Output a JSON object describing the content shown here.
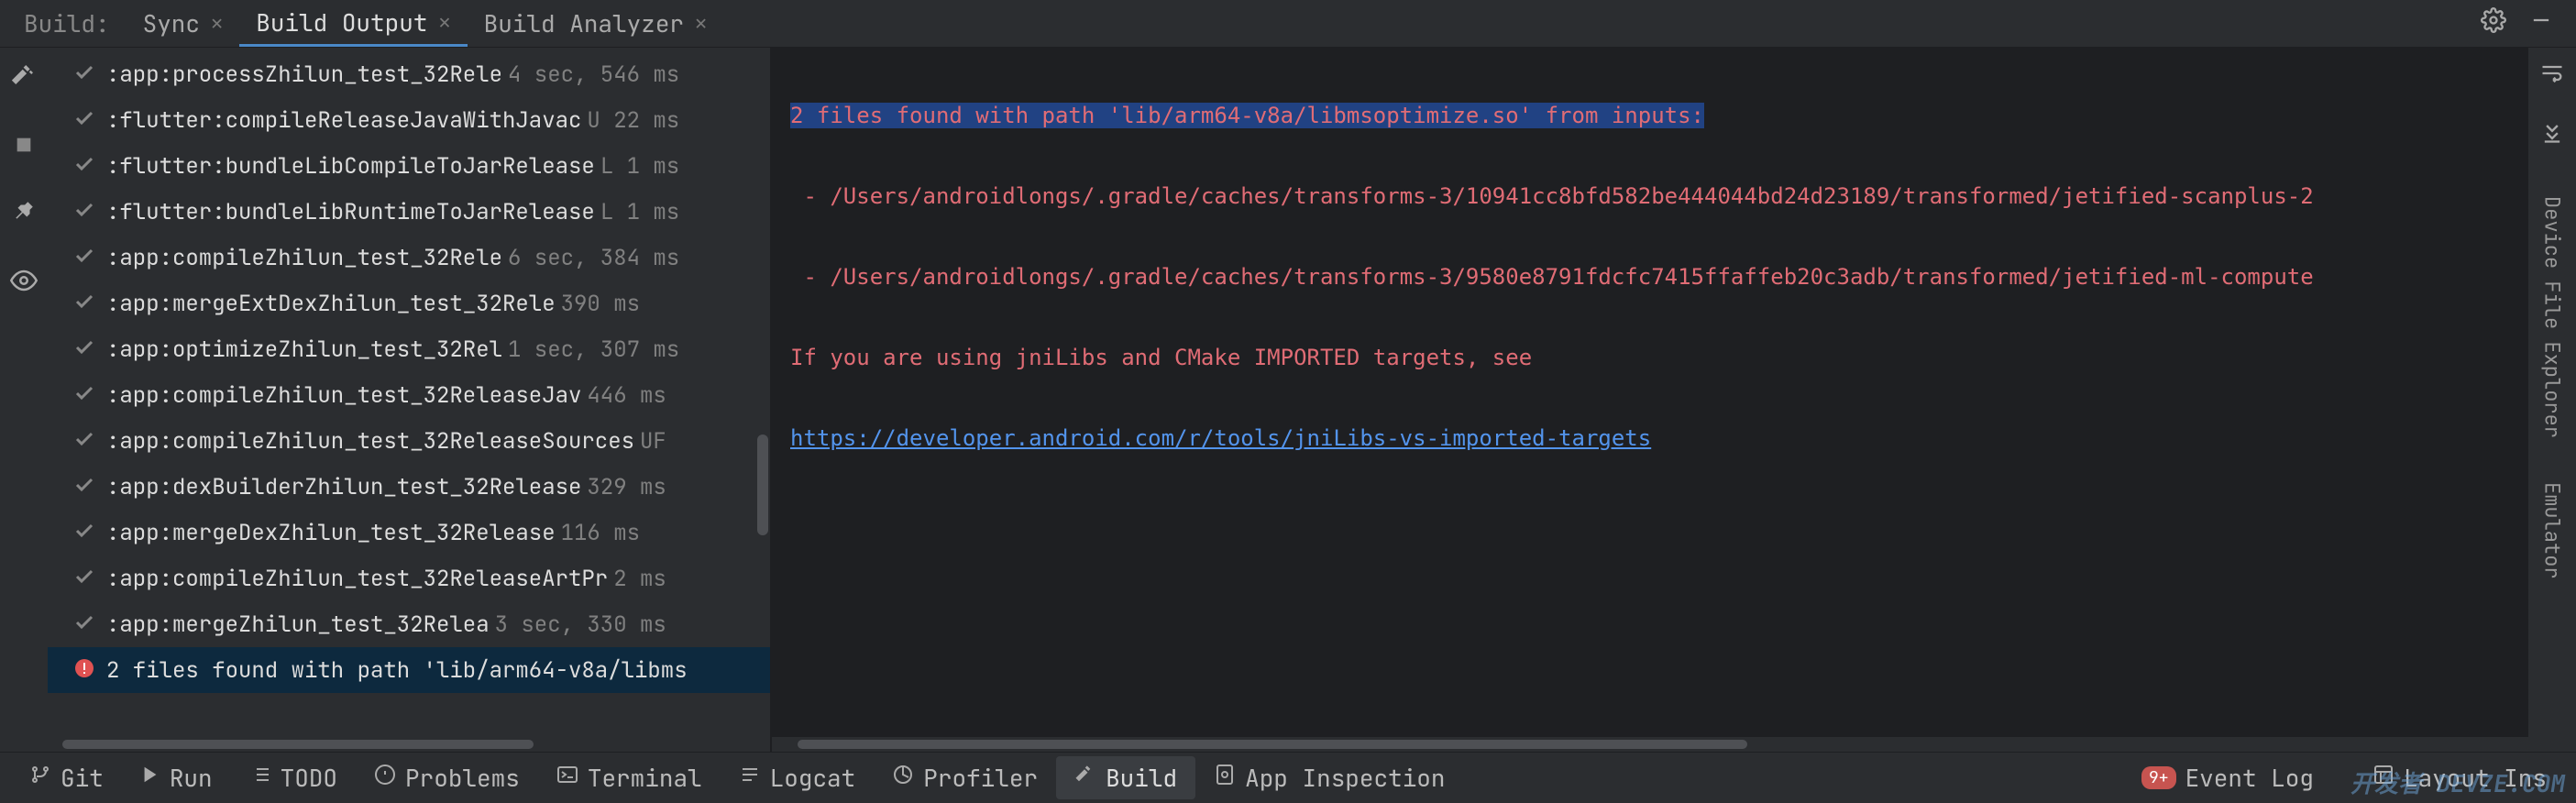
{
  "header": {
    "build_label": "Build:",
    "tabs": [
      {
        "label": "Sync",
        "closable": true,
        "active": false
      },
      {
        "label": "Build Output",
        "closable": true,
        "active": true
      },
      {
        "label": "Build Analyzer",
        "closable": true,
        "active": false
      }
    ]
  },
  "tasks": [
    {
      "ok": true,
      "label": ":app:processZhilun_test_32Rele",
      "time": "4 sec, 546 ms"
    },
    {
      "ok": true,
      "label": ":flutter:compileReleaseJavaWithJavac",
      "time": "U 22 ms"
    },
    {
      "ok": true,
      "label": ":flutter:bundleLibCompileToJarRelease",
      "time": "L 1 ms"
    },
    {
      "ok": true,
      "label": ":flutter:bundleLibRuntimeToJarRelease",
      "time": "L 1 ms"
    },
    {
      "ok": true,
      "label": ":app:compileZhilun_test_32Rele",
      "time": "6 sec, 384 ms"
    },
    {
      "ok": true,
      "label": ":app:mergeExtDexZhilun_test_32Rele",
      "time": "390 ms"
    },
    {
      "ok": true,
      "label": ":app:optimizeZhilun_test_32Rel",
      "time": "1 sec, 307 ms"
    },
    {
      "ok": true,
      "label": ":app:compileZhilun_test_32ReleaseJav",
      "time": "446 ms"
    },
    {
      "ok": true,
      "label": ":app:compileZhilun_test_32ReleaseSources",
      "time": "UF"
    },
    {
      "ok": true,
      "label": ":app:dexBuilderZhilun_test_32Release",
      "time": "329 ms"
    },
    {
      "ok": true,
      "label": ":app:mergeDexZhilun_test_32Release",
      "time": "116 ms"
    },
    {
      "ok": true,
      "label": ":app:compileZhilun_test_32ReleaseArtPr",
      "time": "2 ms"
    },
    {
      "ok": true,
      "label": ":app:mergeZhilun_test_32Relea",
      "time": "3 sec, 330 ms"
    },
    {
      "ok": false,
      "label": "2 files found with path 'lib/arm64-v8a/libms",
      "time": "",
      "selected": true
    }
  ],
  "output": {
    "line1": "2 files found with path 'lib/arm64-v8a/libmsoptimize.so' from inputs:",
    "line2": " - /Users/androidlongs/.gradle/caches/transforms-3/10941cc8bfd582be444044bd24d23189/transformed/jetified-scanplus-2",
    "line3": " - /Users/androidlongs/.gradle/caches/transforms-3/9580e8791fdcfc7415ffaffeb20c3adb/transformed/jetified-ml-compute",
    "line4": "If you are using jniLibs and CMake IMPORTED targets, see",
    "link": "https://developer.android.com/r/tools/jniLibs-vs-imported-targets"
  },
  "right_panel": {
    "device_file_explorer": "Device File Explorer",
    "emulator": "Emulator"
  },
  "bottom": {
    "git": "Git",
    "run": "Run",
    "todo": "TODO",
    "problems": "Problems",
    "terminal": "Terminal",
    "logcat": "Logcat",
    "profiler": "Profiler",
    "build": "Build",
    "app_inspection": "App Inspection",
    "event_log": "Event Log",
    "event_badge": "9+",
    "layout_inspector": "Layout Ins"
  },
  "watermark": "开发者 DEVZE.COM"
}
